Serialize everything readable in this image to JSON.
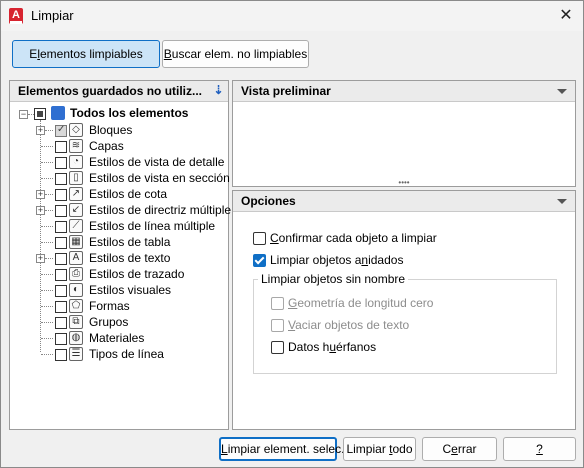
{
  "window": {
    "title": "Limpiar",
    "app_icon_letter": "A"
  },
  "tabs": [
    {
      "label_pre": "E",
      "label_u": "l",
      "label_post": "ementos limpiables",
      "active": true
    },
    {
      "label_pre": "",
      "label_u": "B",
      "label_post": "uscar elem. no limpiables",
      "active": false
    }
  ],
  "left_panel": {
    "header": "Elementos guardados no utiliz...",
    "root": {
      "label": "Todos los elementos"
    },
    "items": [
      {
        "label": "Bloques",
        "icon": "blocks-icon",
        "glyph": "◇",
        "expandable": true,
        "state": "checked-gray"
      },
      {
        "label": "Capas",
        "icon": "layers-icon",
        "glyph": "≋",
        "expandable": false,
        "state": "unchecked"
      },
      {
        "label": "Estilos de vista de detalle",
        "icon": "detail-view-style-icon",
        "glyph": "◔",
        "expandable": false,
        "state": "unchecked"
      },
      {
        "label": "Estilos de vista en sección",
        "icon": "section-view-style-icon",
        "glyph": "▯",
        "expandable": false,
        "state": "unchecked"
      },
      {
        "label": "Estilos de cota",
        "icon": "dimension-style-icon",
        "glyph": "↗",
        "expandable": true,
        "state": "unchecked"
      },
      {
        "label": "Estilos de directriz múltiple",
        "icon": "multileader-style-icon",
        "glyph": "↙",
        "expandable": true,
        "state": "unchecked"
      },
      {
        "label": "Estilos de línea múltiple",
        "icon": "multiline-style-icon",
        "glyph": "⟋",
        "expandable": false,
        "state": "unchecked"
      },
      {
        "label": "Estilos de tabla",
        "icon": "table-style-icon",
        "glyph": "▦",
        "expandable": false,
        "state": "unchecked"
      },
      {
        "label": "Estilos de texto",
        "icon": "text-style-icon",
        "glyph": "A",
        "expandable": true,
        "state": "unchecked"
      },
      {
        "label": "Estilos de trazado",
        "icon": "plot-style-icon",
        "glyph": "⎙",
        "expandable": false,
        "state": "unchecked"
      },
      {
        "label": "Estilos visuales",
        "icon": "visual-style-icon",
        "glyph": "◐",
        "expandable": false,
        "state": "unchecked"
      },
      {
        "label": "Formas",
        "icon": "shapes-icon",
        "glyph": "⬠",
        "expandable": false,
        "state": "unchecked"
      },
      {
        "label": "Grupos",
        "icon": "groups-icon",
        "glyph": "⧉",
        "expandable": false,
        "state": "unchecked"
      },
      {
        "label": "Materiales",
        "icon": "materials-icon",
        "glyph": "◍",
        "expandable": false,
        "state": "unchecked"
      },
      {
        "label": "Tipos de línea",
        "icon": "linetypes-icon",
        "glyph": "☰",
        "expandable": false,
        "state": "unchecked"
      }
    ]
  },
  "preview_panel": {
    "header": "Vista preliminar"
  },
  "options_panel": {
    "header": "Opciones",
    "confirm": {
      "pre": "",
      "u": "C",
      "post": "onfirmar cada objeto a limpiar",
      "checked": false
    },
    "nested": {
      "pre": "Limpiar objetos a",
      "u": "n",
      "post": "idados",
      "checked": true
    },
    "group_title": "Limpiar objetos sin nombre",
    "zero_geom": {
      "pre": "",
      "u": "G",
      "post": "eometría de longitud cero",
      "checked": false,
      "disabled": true
    },
    "empty_text": {
      "pre": "",
      "u": "V",
      "post": "aciar objetos de texto",
      "checked": false,
      "disabled": true
    },
    "orphan": {
      "pre": "Datos h",
      "u": "u",
      "post": "érfanos",
      "checked": false,
      "disabled": false
    }
  },
  "buttons": {
    "purge_selected": {
      "pre": "",
      "u": "L",
      "post": "impiar element. selec."
    },
    "purge_all": {
      "pre": "Limpiar ",
      "u": "t",
      "post": "odo"
    },
    "close": {
      "pre": "C",
      "u": "e",
      "post": "rrar"
    },
    "help": {
      "pre": "",
      "u": "?",
      "post": ""
    }
  }
}
